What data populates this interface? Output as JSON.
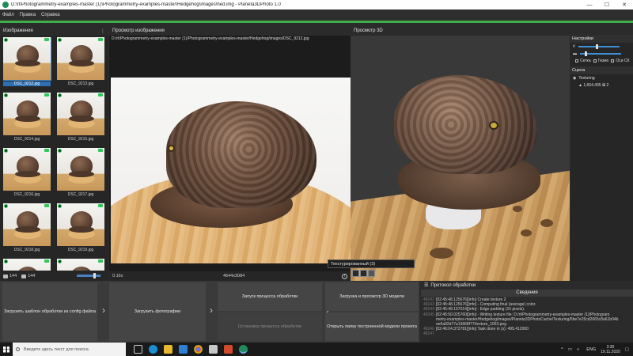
{
  "window": {
    "title": "D:\\rt\\Photogrammetry-examples-master (1)\\Photogrammetry-examples-master\\Hedgehog\\images\\hed.img - Planeta3DPhoto 1.0",
    "minimize": "—",
    "maximize": "☐",
    "close": "✕"
  },
  "menu": [
    "Файл",
    "Правка",
    "Справка"
  ],
  "colors": {
    "accent": "#3fae49",
    "selection": "#2f6fb3",
    "ok": "#34c759"
  },
  "images_panel": {
    "title": "Изображения",
    "menu_icon": "⋮",
    "thumbnails": [
      {
        "name": "DSC_9212.jpg",
        "selected": true
      },
      {
        "name": "DSC_9213.jpg",
        "selected": false
      },
      {
        "name": "DSC_9214.jpg",
        "selected": false
      },
      {
        "name": "DSC_9215.jpg",
        "selected": false
      },
      {
        "name": "DSC_9216.jpg",
        "selected": false
      },
      {
        "name": "DSC_9217.jpg",
        "selected": false
      },
      {
        "name": "DSC_9218.jpg",
        "selected": false
      },
      {
        "name": "DSC_9219.jpg",
        "selected": false
      },
      {
        "name": "",
        "selected": false
      },
      {
        "name": "",
        "selected": false
      }
    ],
    "count_a": "144",
    "count_b": "144"
  },
  "preview_panel": {
    "title": "Просмотр изображения",
    "path": "D:/rt/Photogrammetry-examples-master (1)/Photogrammetry-examples-master/Hedgehog/images/DSC_9212.jpg",
    "zoom": "0.16x",
    "resolution": "4644x3084",
    "info_icon": "i"
  },
  "view3d": {
    "title": "Просмотр 3D",
    "mode_label": "Текстурированный (3)"
  },
  "settings": {
    "title": "Настройки",
    "checks": [
      "Сетка",
      "Гизмо",
      "Оси СК"
    ]
  },
  "scene": {
    "title": "Сцена",
    "item": "Texturing",
    "stats": "▲ 1,664,405  ⊠ 2"
  },
  "workflow": {
    "load_template": "Загрузить шаблон обработки из config файла",
    "load_photos": "Загрузить фотографии",
    "start_processing": "Запуск процесса обработки",
    "stop_processing": "Остановка процесса обработки",
    "load_3d": "Загрузка и просмотр 3D модели",
    "open_folder": "Открыть папку построенной модели проекта"
  },
  "log": {
    "title": "Протокол обработки",
    "tab": "Сведения",
    "lines": [
      {
        "no": "48242",
        "text": "[02:45:48.125676][info] Create texture 2"
      },
      {
        "no": "48243",
        "text": "[02:45:48.125676][info]  - Computing final (average) color."
      },
      {
        "no": "48244",
        "text": "[02:45:48.197014][info]  - Edge padding (15 pixels)."
      },
      {
        "no": "48245",
        "text": "[02:45:50.025760][info]  - Writing texture file: D:/rt/Photogrammetry-examples-master (1)/Photogram"
      },
      {
        "no": "",
        "text": "metry-examples-master/Hedgehog/images/Planeta3DPhotoCache/Texturing/5be7e25cd2665c8a61b04b"
      },
      {
        "no": "",
        "text": "ee6a92d77a15668f77/texture_1002.png"
      },
      {
        "no": "48246",
        "text": "[02:46:04.372781][info] Task done in (s): 495.412000"
      },
      {
        "no": "48247",
        "text": ""
      }
    ]
  },
  "taskbar": {
    "search_placeholder": "Введите здесь текст для поиска",
    "lang": "ENG",
    "time": "3:30",
    "date": "19.11.2020"
  }
}
